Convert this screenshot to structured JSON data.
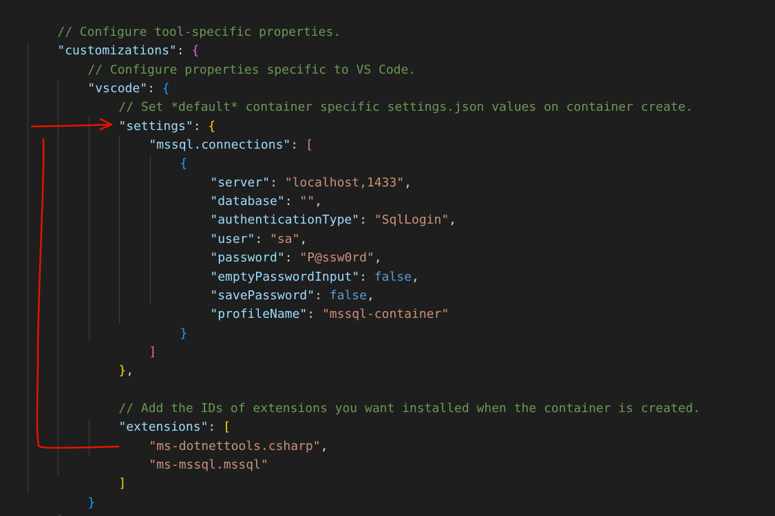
{
  "code": {
    "l1_comment": "// Configure tool-specific properties.",
    "l2_key": "\"customizations\"",
    "l3_comment": "// Configure properties specific to VS Code.",
    "l4_key": "\"vscode\"",
    "l5_comment": "// Set *default* container specific settings.json values on container create.",
    "l6_key": "\"settings\"",
    "l7_key": "\"mssql.connections\"",
    "server_key": "\"server\"",
    "server_val": "\"localhost,1433\"",
    "database_key": "\"database\"",
    "database_val": "\"\"",
    "auth_key": "\"authenticationType\"",
    "auth_val": "\"SqlLogin\"",
    "user_key": "\"user\"",
    "user_val": "\"sa\"",
    "password_key": "\"password\"",
    "password_val": "\"P@ssw0rd\"",
    "empty_key": "\"emptyPasswordInput\"",
    "empty_val": "false",
    "save_key": "\"savePassword\"",
    "save_val": "false",
    "profile_key": "\"profileName\"",
    "profile_val": "\"mssql-container\"",
    "ext_comment": "// Add the IDs of extensions you want installed when the container is created.",
    "ext_key": "\"extensions\"",
    "ext1": "\"ms-dotnettools.csharp\"",
    "ext2": "\"ms-mssql.mssql\""
  },
  "colors": {
    "background": "#1e1e1e",
    "comment": "#6a9955",
    "key": "#9cdcfe",
    "string": "#ce9178",
    "boolean": "#569cd6",
    "annotation": "#e51400"
  }
}
